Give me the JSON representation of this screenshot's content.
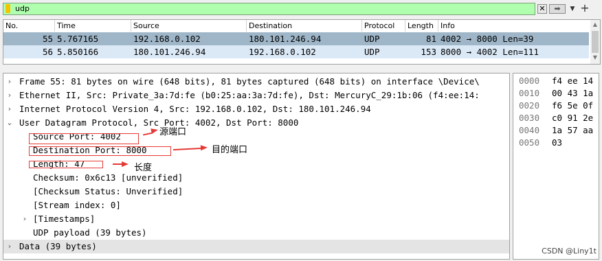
{
  "filter": {
    "value": "udp",
    "clear_glyph": "✕",
    "apply_glyph": "➡",
    "dropdown_glyph": "▼",
    "add_glyph": "+"
  },
  "packet_list": {
    "columns": [
      "No.",
      "Time",
      "Source",
      "Destination",
      "Protocol",
      "Length",
      "Info"
    ],
    "rows": [
      {
        "no": "55",
        "time": "5.767165",
        "source": "192.168.0.102",
        "destination": "180.101.246.94",
        "protocol": "UDP",
        "length": "81",
        "info": "4002 → 8000 Len=39"
      },
      {
        "no": "56",
        "time": "5.850166",
        "source": "180.101.246.94",
        "destination": "192.168.0.102",
        "protocol": "UDP",
        "length": "153",
        "info": "8000 → 4002 Len=111"
      }
    ]
  },
  "details": {
    "frame": "Frame 55: 81 bytes on wire (648 bits), 81 bytes captured (648 bits) on interface \\Device\\",
    "ethernet": "Ethernet II, Src: Private_3a:7d:fe (b0:25:aa:3a:7d:fe), Dst: MercuryC_29:1b:06 (f4:ee:14:",
    "ip": "Internet Protocol Version 4, Src: 192.168.0.102, Dst: 180.101.246.94",
    "udp": "User Datagram Protocol, Src Port: 4002, Dst Port: 8000",
    "src_port": "Source Port: 4002",
    "dst_port": "Destination Port: 8000",
    "length": "Length: 47",
    "checksum": "Checksum: 0x6c13 [unverified]",
    "checksum_status": "[Checksum Status: Unverified]",
    "stream_index": "[Stream index: 0]",
    "timestamps": "[Timestamps]",
    "payload": "UDP payload (39 bytes)",
    "data": "Data (39 bytes)"
  },
  "hex": [
    {
      "offset": "0000",
      "bytes": "f4 ee 14"
    },
    {
      "offset": "0010",
      "bytes": "00 43 1a"
    },
    {
      "offset": "0020",
      "bytes": "f6 5e 0f"
    },
    {
      "offset": "0030",
      "bytes": "c0 91 2e"
    },
    {
      "offset": "0040",
      "bytes": "1a 57 aa"
    },
    {
      "offset": "0050",
      "bytes": "03"
    }
  ],
  "annotations": {
    "src_port_label": "源端口",
    "dst_port_label": "目的端口",
    "length_label": "长度"
  },
  "colors": {
    "filter_ok": "#afffaf",
    "selected_row": "#9fb6c8",
    "secondary_row": "#dbe9f7",
    "annotation_red": "#e53935"
  },
  "watermark": "CSDN @Liny1t"
}
